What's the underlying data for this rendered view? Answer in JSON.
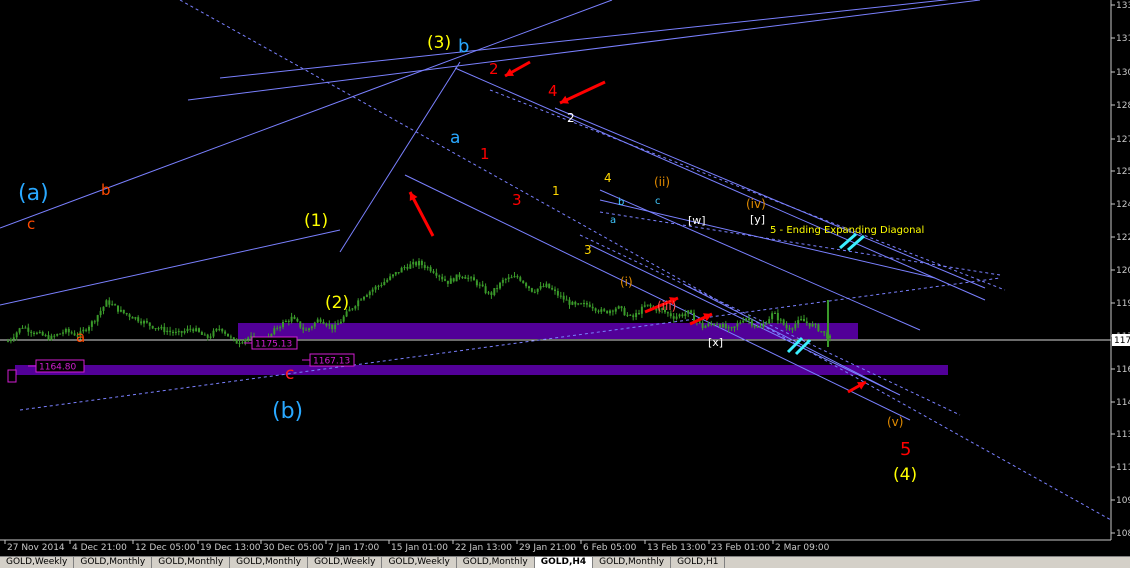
{
  "chart_data": {
    "type": "candlestick",
    "symbol": "GOLD",
    "timeframe": "H4",
    "y_ticks": [
      "133",
      "131",
      "130",
      "128",
      "127",
      "125",
      "124",
      "122",
      "120",
      "119",
      "117",
      "116",
      "114",
      "113",
      "111",
      "109",
      "108"
    ],
    "current_price_label": "117",
    "x_ticks": [
      "27 Nov 2014",
      "4 Dec 21:00",
      "12 Dec 05:00",
      "19 Dec 13:00",
      "30 Dec 05:00",
      "7 Jan 17:00",
      "15 Jan 01:00",
      "22 Jan 13:00",
      "29 Jan 21:00",
      "6 Feb 05:00",
      "13 Feb 13:00",
      "23 Feb 01:00",
      "2 Mar 09:00"
    ],
    "price_path": [
      1173,
      1198,
      1186,
      1178,
      1190,
      1183,
      1206,
      1240,
      1222,
      1212,
      1200,
      1192,
      1185,
      1195,
      1178,
      1196,
      1170,
      1180,
      1167,
      1197,
      1212,
      1190,
      1211,
      1194,
      1222,
      1249,
      1264,
      1280,
      1298,
      1304,
      1292,
      1272,
      1285,
      1272,
      1250,
      1276,
      1281,
      1258,
      1266,
      1247,
      1232,
      1235,
      1221,
      1230,
      1211,
      1233,
      1226,
      1214,
      1221,
      1197,
      1204,
      1190,
      1214,
      1193,
      1220,
      1194,
      1208,
      1197,
      1178
    ],
    "price_boxes": [
      {
        "value": "1164.80",
        "color": "#d21ed2"
      },
      {
        "value": "1175.13",
        "color": "#d21ed2"
      },
      {
        "value": "1167.13",
        "color": "#d21ed2"
      }
    ],
    "annotations": [
      {
        "text": "(a)",
        "color": "#29a8ff"
      },
      {
        "text": "(b)",
        "color": "#29a8ff"
      },
      {
        "text": "b",
        "color": "#29a8ff"
      },
      {
        "text": "a",
        "color": "#29a8ff"
      },
      {
        "text": "c",
        "color": "#ff4a00"
      },
      {
        "text": "b",
        "color": "#ff4a00"
      },
      {
        "text": "a",
        "color": "#ff4a00"
      },
      {
        "text": "c",
        "color": "#ff2020"
      },
      {
        "text": "(1)",
        "color": "#ffff00"
      },
      {
        "text": "(2)",
        "color": "#ffff00"
      },
      {
        "text": "(3)",
        "color": "#ffff00"
      },
      {
        "text": "(4)",
        "color": "#ffff00"
      },
      {
        "text": "2",
        "color": "#ff0000"
      },
      {
        "text": "4",
        "color": "#ff0000"
      },
      {
        "text": "1",
        "color": "#ff0000"
      },
      {
        "text": "3",
        "color": "#ff0000"
      },
      {
        "text": "5",
        "color": "#ff0000"
      },
      {
        "text": "2",
        "color": "#ffffff"
      },
      {
        "text": "1",
        "color": "#ffd700"
      },
      {
        "text": "4",
        "color": "#ffd700"
      },
      {
        "text": "3",
        "color": "#ffd700"
      },
      {
        "text": "(ii)",
        "color": "#e08a00"
      },
      {
        "text": "(i)",
        "color": "#e08a00"
      },
      {
        "text": "(iv)",
        "color": "#e08a00"
      },
      {
        "text": "(v)",
        "color": "#e08a00"
      },
      {
        "text": "(iii)",
        "color": "#ff5050"
      },
      {
        "text": "[w]",
        "color": "#ffffff"
      },
      {
        "text": "[y]",
        "color": "#ffffff"
      },
      {
        "text": "[x]",
        "color": "#ffffff"
      },
      {
        "text": "b",
        "color": "#40c8ff"
      },
      {
        "text": "c",
        "color": "#40c8ff"
      },
      {
        "text": "a",
        "color": "#40c8ff"
      },
      {
        "text": "5 - Ending Expanding Diagonal",
        "color": "#ffff00"
      }
    ]
  },
  "tabs": [
    "GOLD,Weekly",
    "GOLD,Monthly",
    "GOLD,Monthly",
    "GOLD,Monthly",
    "GOLD,Weekly",
    "GOLD,Weekly",
    "GOLD,Monthly",
    "GOLD,H4",
    "GOLD,Monthly",
    "GOLD,H1"
  ],
  "active_tab": "GOLD,H4"
}
